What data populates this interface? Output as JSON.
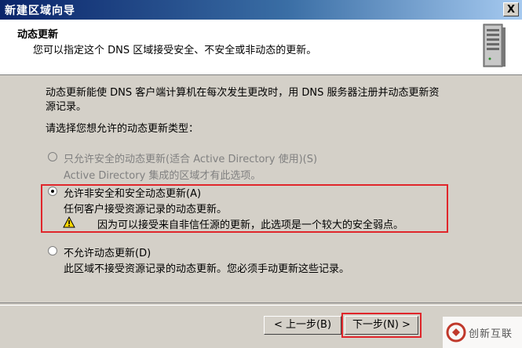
{
  "window": {
    "title": "新建区域向导",
    "close_label": "X"
  },
  "header": {
    "title": "动态更新",
    "description": "您可以指定这个 DNS 区域接受安全、不安全或非动态的更新。"
  },
  "body": {
    "intro_line1": "动态更新能使 DNS 客户端计算机在每次发生更改时，用 DNS 服务器注册并动态更新资",
    "intro_line2": "源记录。",
    "prompt": "请选择您想允许的动态更新类型：",
    "options": [
      {
        "label": "只允许安全的动态更新(适合 Active Directory 使用)(S)",
        "desc": "Active Directory 集成的区域才有此选项。",
        "checked": false,
        "disabled": true
      },
      {
        "label": "允许非安全和安全动态更新(A)",
        "desc": "任何客户接受资源记录的动态更新。",
        "warning": "因为可以接受来自非信任源的更新，此选项是一个较大的安全弱点。",
        "checked": true,
        "disabled": false
      },
      {
        "label": "不允许动态更新(D)",
        "desc": "此区域不接受资源记录的动态更新。您必须手动更新这些记录。",
        "checked": false,
        "disabled": false
      }
    ]
  },
  "buttons": {
    "back": "< 上一步(B)",
    "next": "下一步(N) >"
  },
  "watermark": {
    "text": "创新互联"
  },
  "colors": {
    "highlight": "#e0262b",
    "dialog_bg": "#d4d0c8"
  },
  "icons": {
    "server": "server-icon",
    "warning": "warning-icon",
    "logo": "chuangxin-logo-icon"
  }
}
